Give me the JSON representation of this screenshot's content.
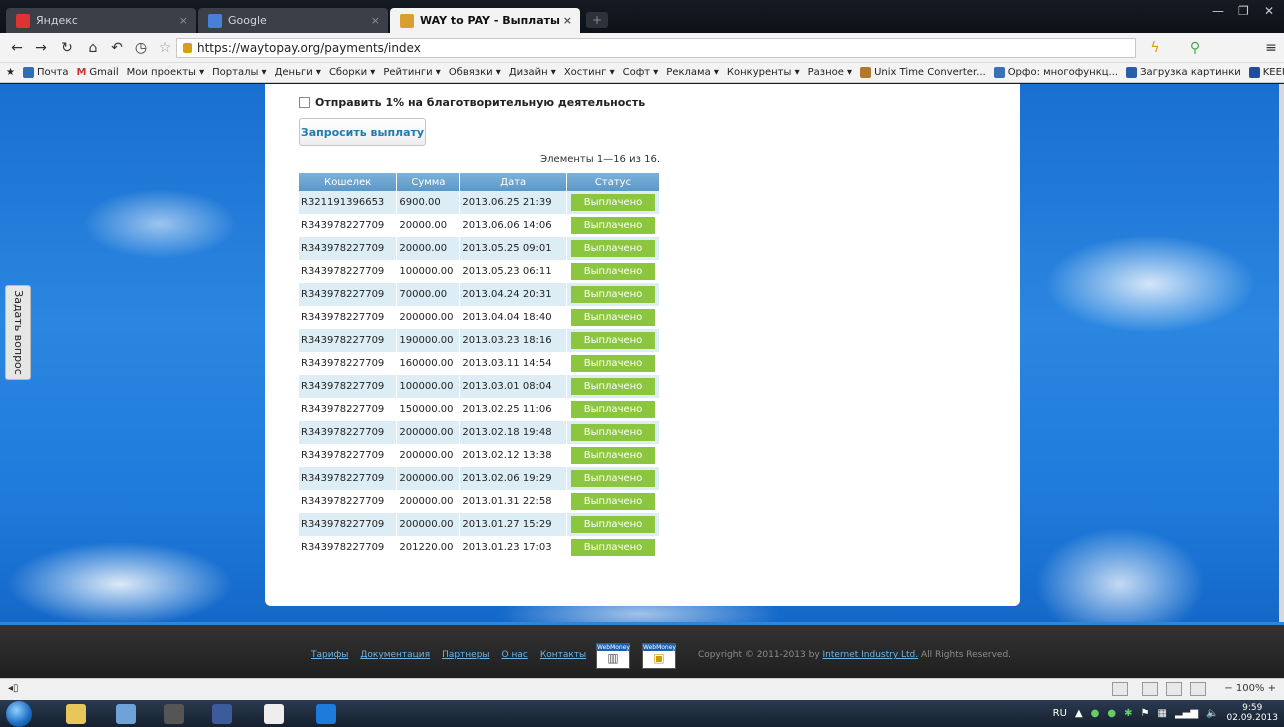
{
  "browser": {
    "tabs": [
      {
        "label": "Яндекс",
        "icon": "yandex-icon"
      },
      {
        "label": "Google",
        "icon": "google-icon"
      },
      {
        "label": "WAY to PAY - Выплаты",
        "icon": "waytopay-icon"
      }
    ],
    "url": "https://waytopay.org/payments/index",
    "bookmarks": [
      "Почта",
      "Gmail",
      "Мои проекты ▾",
      "Порталы ▾",
      "Деньги ▾",
      "Сборки ▾",
      "Рейтинги ▾",
      "Обвязки ▾",
      "Дизайн ▾",
      "Хостинг ▾",
      "Софт ▾",
      "Реклама ▾",
      "Конкуренты ▾",
      "Разное ▾",
      "Unix Time Converter...",
      "Орфо: многофункц...",
      "Загрузка картинки",
      "KEENETIC"
    ]
  },
  "page": {
    "charity_label": "Отправить 1% на благотворительную деятельность",
    "request_button": "Запросить выплату",
    "summary": "Элементы 1—16 из 16.",
    "ask_tab": "Задать вопрос",
    "columns": [
      "Кошелек",
      "Сумма",
      "Дата",
      "Статус"
    ],
    "rows": [
      {
        "wallet": "R321191396653",
        "amount": "6900.00",
        "date": "2013.06.25 21:39",
        "status": "Выплачено"
      },
      {
        "wallet": "R343978227709",
        "amount": "20000.00",
        "date": "2013.06.06 14:06",
        "status": "Выплачено"
      },
      {
        "wallet": "R343978227709",
        "amount": "20000.00",
        "date": "2013.05.25 09:01",
        "status": "Выплачено"
      },
      {
        "wallet": "R343978227709",
        "amount": "100000.00",
        "date": "2013.05.23 06:11",
        "status": "Выплачено"
      },
      {
        "wallet": "R343978227709",
        "amount": "70000.00",
        "date": "2013.04.24 20:31",
        "status": "Выплачено"
      },
      {
        "wallet": "R343978227709",
        "amount": "200000.00",
        "date": "2013.04.04 18:40",
        "status": "Выплачено"
      },
      {
        "wallet": "R343978227709",
        "amount": "190000.00",
        "date": "2013.03.23 18:16",
        "status": "Выплачено"
      },
      {
        "wallet": "R343978227709",
        "amount": "160000.00",
        "date": "2013.03.11 14:54",
        "status": "Выплачено"
      },
      {
        "wallet": "R343978227709",
        "amount": "100000.00",
        "date": "2013.03.01 08:04",
        "status": "Выплачено"
      },
      {
        "wallet": "R343978227709",
        "amount": "150000.00",
        "date": "2013.02.25 11:06",
        "status": "Выплачено"
      },
      {
        "wallet": "R343978227709",
        "amount": "200000.00",
        "date": "2013.02.18 19:48",
        "status": "Выплачено"
      },
      {
        "wallet": "R343978227709",
        "amount": "200000.00",
        "date": "2013.02.12 13:38",
        "status": "Выплачено"
      },
      {
        "wallet": "R343978227709",
        "amount": "200000.00",
        "date": "2013.02.06 19:29",
        "status": "Выплачено"
      },
      {
        "wallet": "R343978227709",
        "amount": "200000.00",
        "date": "2013.01.31 22:58",
        "status": "Выплачено"
      },
      {
        "wallet": "R343978227709",
        "amount": "200000.00",
        "date": "2013.01.27 15:29",
        "status": "Выплачено"
      },
      {
        "wallet": "R343978227709",
        "amount": "201220.00",
        "date": "2013.01.23 17:03",
        "status": "Выплачено"
      }
    ]
  },
  "footer": {
    "links": [
      "Тарифы",
      "Документация",
      "Партнеры",
      "О нас",
      "Контакты"
    ],
    "webmoney_label": "WebMoney",
    "copyright_prefix": "Copyright © 2011-2013 by",
    "copyright_link": "Internet Industry Ltd.",
    "copyright_suffix": "All Rights Reserved."
  },
  "statusbar": {
    "zoom": "100%"
  },
  "taskbar": {
    "lang": "RU",
    "time": "9:59",
    "date": "02.09.2013"
  },
  "colors": {
    "accent": "#2f86d8",
    "status_paid": "#8cc63f",
    "table_header": "#6aa3d0",
    "row_alt": "#dcedf5"
  }
}
